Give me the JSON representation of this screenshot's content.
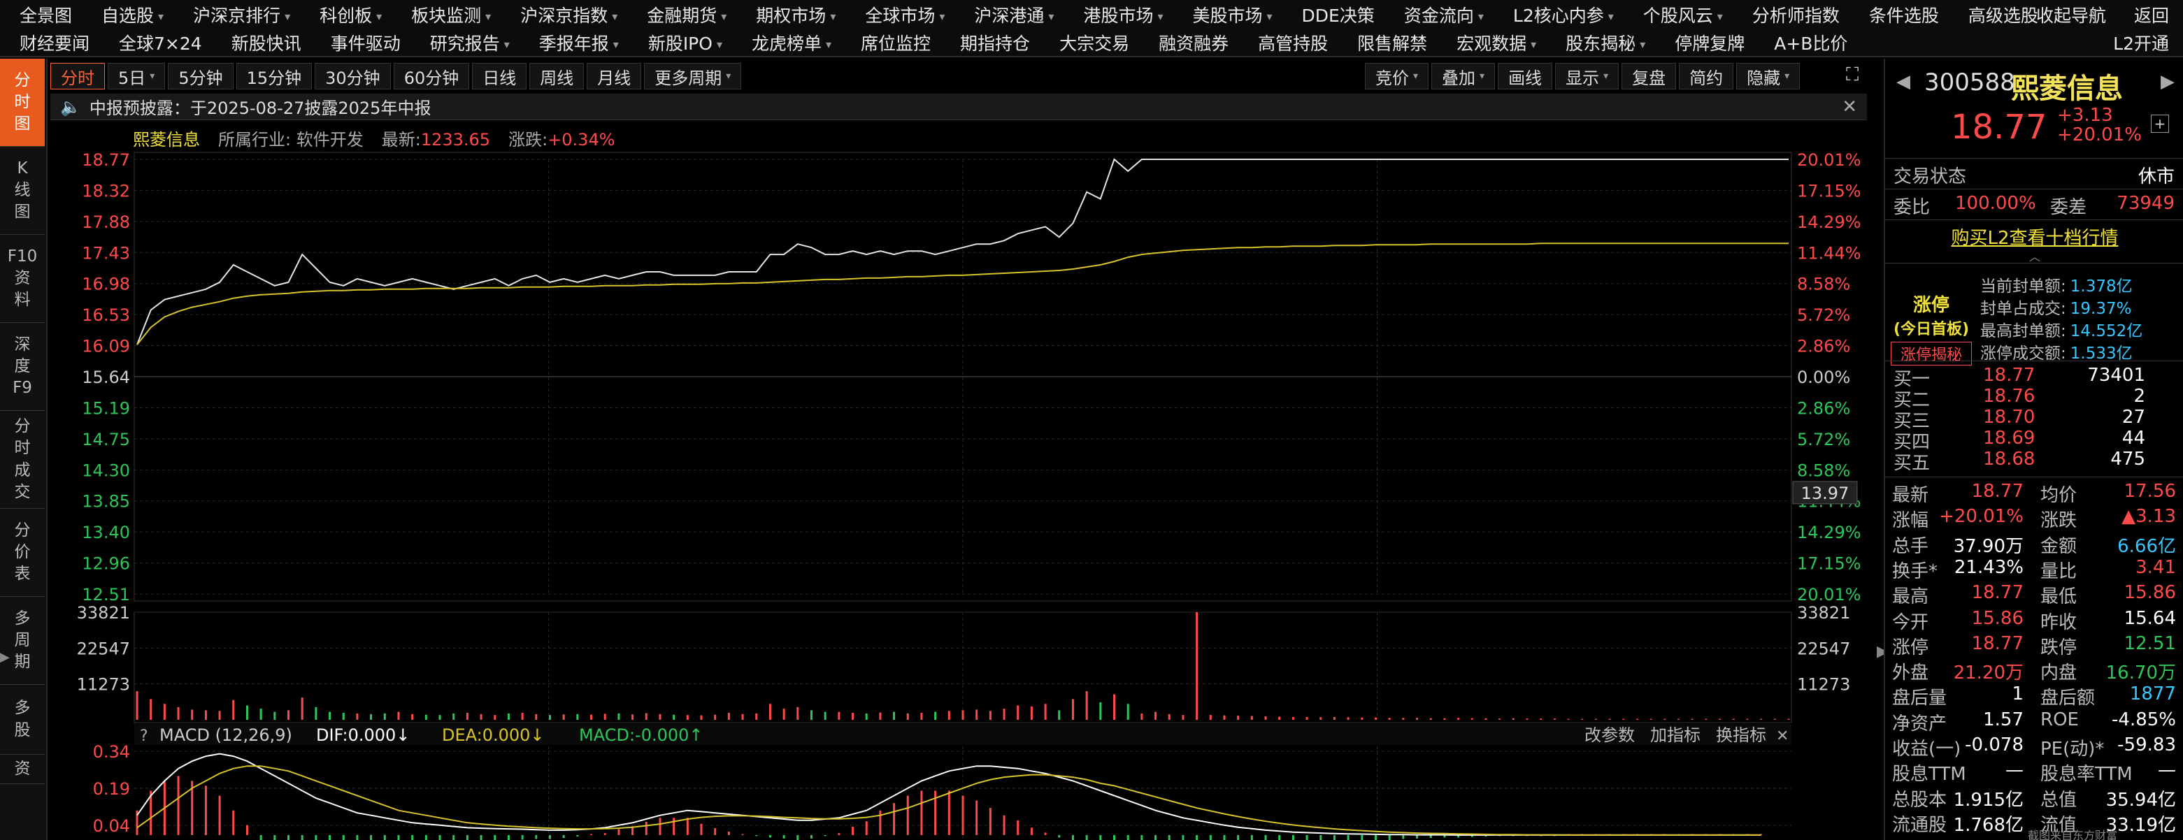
{
  "menu1": {
    "items": [
      "全景图",
      "自选股",
      "沪深京排行",
      "科创板",
      "板块监测",
      "沪深京指数",
      "金融期货",
      "期权市场",
      "全球市场",
      "沪深港通",
      "港股市场",
      "美股市场",
      "DDE决策",
      "资金流向",
      "L2核心内参",
      "个股风云",
      "分析师指数",
      "条件选股",
      "高级选股"
    ],
    "dropdown": [
      false,
      true,
      true,
      true,
      true,
      true,
      true,
      true,
      true,
      true,
      true,
      true,
      false,
      true,
      true,
      true,
      false,
      false,
      false
    ],
    "right": [
      "收起导航",
      "返回"
    ]
  },
  "menu2": {
    "items": [
      "财经要闻",
      "全球7×24",
      "新股快讯",
      "事件驱动",
      "研究报告",
      "季报年报",
      "新股IPO",
      "龙虎榜单",
      "席位监控",
      "期指持仓",
      "大宗交易",
      "融资融券",
      "高管持股",
      "限售解禁",
      "宏观数据",
      "股东揭秘",
      "停牌复牌",
      "A+B比价"
    ],
    "dropdown": [
      false,
      false,
      false,
      false,
      true,
      true,
      true,
      true,
      false,
      false,
      false,
      false,
      false,
      false,
      true,
      true,
      false,
      false
    ],
    "right": [
      "L2开通"
    ]
  },
  "sidebar": [
    {
      "label": "分\n时\n图",
      "active": true
    },
    {
      "label": "K\n线\n图",
      "active": false
    },
    {
      "label": "F10\n资\n料",
      "active": false
    },
    {
      "label": "深\n度\nF9",
      "active": false
    },
    {
      "label": "分\n时\n成\n交",
      "active": false
    },
    {
      "label": "分\n价\n表",
      "active": false
    },
    {
      "label": "多\n周\n期",
      "active": false
    },
    {
      "label": "多\n股",
      "active": false
    },
    {
      "label": "资",
      "active": false
    }
  ],
  "toolbar": {
    "periods": [
      "分时",
      "5日",
      "5分钟",
      "15分钟",
      "30分钟",
      "60分钟",
      "日线",
      "周线",
      "月线",
      "更多周期"
    ],
    "period_dropdown": [
      false,
      true,
      false,
      false,
      false,
      false,
      false,
      false,
      false,
      true
    ],
    "right": [
      "竞价",
      "叠加",
      "画线",
      "显示",
      "复盘",
      "简约",
      "隐藏"
    ]
  },
  "notice": {
    "text": "中报预披露：于2025-08-27披露2025年中报",
    "close": "✕"
  },
  "info": {
    "name": "熙菱信息",
    "industry_label": "所属行业:",
    "industry": "软件开发",
    "latest_label": "最新:",
    "latest": "1233.65",
    "change_label": "涨跌:",
    "change": "+0.34%"
  },
  "quote": {
    "code": "300588",
    "name": "熙菱信息",
    "price": "18.77",
    "change": "+3.13",
    "pct": "+20.01%"
  },
  "status": {
    "label": "交易状态",
    "value": "休市"
  },
  "weibi": {
    "label": "委比",
    "value": "100.00%",
    "diff_label": "委差",
    "diff": "73949"
  },
  "buy_l2": "购买L2查看十档行情",
  "limit_up": {
    "badge1": "涨停",
    "badge2": "(今日首板)",
    "badge3": "涨停揭秘",
    "rows": [
      {
        "label": "当前封单额:",
        "value": "1.378亿"
      },
      {
        "label": "封单占成交:",
        "value": "19.37%"
      },
      {
        "label": "最高封单额:",
        "value": "14.552亿"
      },
      {
        "label": "涨停成交额:",
        "value": "1.533亿"
      }
    ]
  },
  "orderbook": [
    {
      "label": "买一",
      "price": "18.77",
      "vol": "73401"
    },
    {
      "label": "买二",
      "price": "18.76",
      "vol": "2"
    },
    {
      "label": "买三",
      "price": "18.70",
      "vol": "27"
    },
    {
      "label": "买四",
      "price": "18.69",
      "vol": "44"
    },
    {
      "label": "买五",
      "price": "18.68",
      "vol": "475"
    }
  ],
  "stats": [
    {
      "l1": "最新",
      "v1": "18.77",
      "c1": "red",
      "l2": "均价",
      "v2": "17.56",
      "c2": "red"
    },
    {
      "l1": "涨幅",
      "v1": "+20.01%",
      "c1": "red",
      "l2": "涨跌",
      "v2": "▲3.13",
      "c2": "red"
    },
    {
      "l1": "总手",
      "v1": "37.90万",
      "c1": "white",
      "l2": "金额",
      "v2": "6.66亿",
      "c2": "cyan"
    },
    {
      "l1": "换手*",
      "v1": "21.43%",
      "c1": "white",
      "l2": "量比",
      "v2": "3.41",
      "c2": "red"
    },
    {
      "l1": "最高",
      "v1": "18.77",
      "c1": "red",
      "l2": "最低",
      "v2": "15.86",
      "c2": "red"
    },
    {
      "l1": "今开",
      "v1": "15.86",
      "c1": "red",
      "l2": "昨收",
      "v2": "15.64",
      "c2": "white"
    },
    {
      "l1": "涨停",
      "v1": "18.77",
      "c1": "red",
      "l2": "跌停",
      "v2": "12.51",
      "c2": "green"
    },
    {
      "l1": "外盘",
      "v1": "21.20万",
      "c1": "red",
      "l2": "内盘",
      "v2": "16.70万",
      "c2": "green"
    },
    {
      "l1": "盘后量",
      "v1": "1",
      "c1": "white",
      "l2": "盘后额",
      "v2": "1877",
      "c2": "cyan"
    },
    {
      "l1": "净资产",
      "v1": "1.57",
      "c1": "white",
      "l2": "ROE",
      "v2": "-4.85%",
      "c2": "white"
    },
    {
      "l1": "收益(一)",
      "v1": "-0.078",
      "c1": "white",
      "l2": "PE(动)*",
      "v2": "-59.83",
      "c2": "white"
    },
    {
      "l1": "股息TTM",
      "v1": "—",
      "c1": "white",
      "l2": "股息率TTM",
      "v2": "—",
      "c2": "white"
    },
    {
      "l1": "总股本",
      "v1": "1.915亿",
      "c1": "white",
      "l2": "总值",
      "v2": "35.94亿",
      "c2": "white"
    },
    {
      "l1": "流通股",
      "v1": "1.768亿",
      "c1": "white",
      "l2": "流值",
      "v2": "33.19亿",
      "c2": "white"
    }
  ],
  "chart_labels": {
    "price_ticks": [
      "18.77",
      "18.32",
      "17.88",
      "17.43",
      "16.98",
      "16.53",
      "16.09",
      "15.64",
      "15.19",
      "14.75",
      "14.30",
      "13.85",
      "13.40",
      "12.96",
      "12.51"
    ],
    "pct_ticks": [
      "20.01%",
      "17.15%",
      "14.29%",
      "11.44%",
      "8.58%",
      "5.72%",
      "2.86%",
      "0.00%",
      "2.86%",
      "5.72%",
      "8.58%",
      "11.44%",
      "14.29%",
      "17.15%",
      "20.01%"
    ],
    "crosshair_value": "13.97",
    "vol_ticks": [
      "33821",
      "22547",
      "11273"
    ],
    "macd_ticks": [
      "0.34",
      "0.19",
      "0.04"
    ],
    "macd_title": "MACD (12,26,9)",
    "dif": "DIF:0.000↓",
    "dea": "DEA:0.000↓",
    "macd": "MACD:-0.000↑",
    "macd_buttons": [
      "改参数",
      "加指标",
      "换指标"
    ],
    "help": "?",
    "watermark": "截图来自东方财富"
  },
  "colors": {
    "up": "#ff4a4a",
    "down": "#2ec55a",
    "price_line": "#e6e6e6",
    "avg_line": "#d9c32a",
    "grid": "#2a2a2a",
    "accent": "#e85a1e"
  },
  "chart_data": {
    "type": "line",
    "ylim": [
      12.51,
      18.77
    ],
    "prev_close": 15.64,
    "price": [
      16.1,
      16.6,
      16.75,
      16.8,
      16.85,
      16.9,
      17.0,
      17.25,
      17.15,
      17.05,
      16.95,
      17.0,
      17.4,
      17.2,
      17.0,
      16.95,
      17.05,
      17.0,
      16.95,
      17.0,
      17.05,
      17.0,
      16.95,
      16.9,
      16.95,
      17.0,
      17.05,
      16.95,
      17.05,
      17.1,
      17.0,
      17.05,
      17.0,
      17.05,
      17.1,
      17.05,
      17.1,
      17.15,
      17.15,
      17.1,
      17.1,
      17.1,
      17.1,
      17.15,
      17.15,
      17.15,
      17.4,
      17.4,
      17.55,
      17.5,
      17.4,
      17.4,
      17.45,
      17.4,
      17.45,
      17.4,
      17.45,
      17.45,
      17.4,
      17.45,
      17.5,
      17.55,
      17.55,
      17.6,
      17.7,
      17.75,
      17.8,
      17.65,
      17.85,
      18.3,
      18.2,
      18.77,
      18.6,
      18.77,
      18.77,
      18.77,
      18.77,
      18.77,
      18.77,
      18.77,
      18.77,
      18.77,
      18.77,
      18.77,
      18.77,
      18.77,
      18.77,
      18.77,
      18.77,
      18.77,
      18.77,
      18.77,
      18.77,
      18.77,
      18.77,
      18.77,
      18.77,
      18.77,
      18.77,
      18.77,
      18.77,
      18.77,
      18.77,
      18.77,
      18.77,
      18.77,
      18.77,
      18.77,
      18.77,
      18.77,
      18.77,
      18.77,
      18.77,
      18.77,
      18.77,
      18.77,
      18.77,
      18.77,
      18.77,
      18.77,
      18.77
    ],
    "avg": [
      16.1,
      16.35,
      16.5,
      16.58,
      16.64,
      16.68,
      16.72,
      16.77,
      16.8,
      16.82,
      16.83,
      16.84,
      16.86,
      16.87,
      16.88,
      16.88,
      16.89,
      16.89,
      16.9,
      16.9,
      16.9,
      16.91,
      16.91,
      16.91,
      16.91,
      16.92,
      16.92,
      16.92,
      16.93,
      16.93,
      16.93,
      16.94,
      16.94,
      16.94,
      16.95,
      16.95,
      16.95,
      16.96,
      16.96,
      16.97,
      16.97,
      16.97,
      16.98,
      16.98,
      16.99,
      16.99,
      17.0,
      17.01,
      17.02,
      17.03,
      17.04,
      17.04,
      17.05,
      17.06,
      17.06,
      17.07,
      17.08,
      17.08,
      17.09,
      17.1,
      17.1,
      17.11,
      17.12,
      17.13,
      17.14,
      17.15,
      17.16,
      17.17,
      17.19,
      17.22,
      17.25,
      17.3,
      17.36,
      17.4,
      17.42,
      17.44,
      17.46,
      17.47,
      17.48,
      17.49,
      17.5,
      17.5,
      17.51,
      17.51,
      17.52,
      17.52,
      17.52,
      17.53,
      17.53,
      17.53,
      17.54,
      17.54,
      17.54,
      17.54,
      17.55,
      17.55,
      17.55,
      17.55,
      17.55,
      17.55,
      17.55,
      17.55,
      17.56,
      17.56,
      17.56,
      17.56,
      17.56,
      17.56,
      17.56,
      17.56,
      17.56,
      17.56,
      17.56,
      17.56,
      17.56,
      17.56,
      17.56,
      17.56,
      17.56,
      17.56,
      17.56
    ],
    "volume": [
      9000,
      6500,
      5000,
      4000,
      3200,
      3000,
      2800,
      6200,
      4500,
      3500,
      2500,
      3000,
      7000,
      4000,
      2500,
      2200,
      2000,
      1800,
      2000,
      2500,
      1800,
      1600,
      1500,
      2000,
      2200,
      1800,
      1500,
      2000,
      2200,
      1800,
      1500,
      1700,
      1800,
      1600,
      1900,
      2000,
      1700,
      2100,
      1800,
      1600,
      1500,
      1400,
      1600,
      2200,
      1800,
      2000,
      5000,
      3500,
      4000,
      3000,
      2500,
      2500,
      2200,
      2000,
      2300,
      2500,
      2000,
      2200,
      2500,
      2800,
      3000,
      3200,
      2800,
      3500,
      4500,
      4200,
      5000,
      3000,
      6500,
      9000,
      5500,
      8000,
      5000,
      2000,
      2500,
      1800,
      1500,
      33821,
      1500,
      1400,
      1300,
      1200,
      1100,
      1000,
      900,
      900,
      800,
      900,
      800,
      700,
      700,
      600,
      600,
      600,
      500,
      500,
      600,
      500,
      500,
      400,
      500,
      400,
      400,
      400,
      300,
      300,
      300,
      300,
      300,
      300,
      300,
      300,
      300,
      300,
      300,
      300,
      300,
      300,
      300,
      300,
      300
    ],
    "macd_range": [
      -0.02,
      0.36
    ],
    "dif": [
      0.08,
      0.16,
      0.22,
      0.27,
      0.3,
      0.32,
      0.33,
      0.32,
      0.3,
      0.27,
      0.24,
      0.21,
      0.18,
      0.15,
      0.13,
      0.11,
      0.09,
      0.08,
      0.07,
      0.06,
      0.05,
      0.045,
      0.04,
      0.035,
      0.03,
      0.028,
      0.026,
      0.025,
      0.024,
      0.022,
      0.02,
      0.02,
      0.022,
      0.025,
      0.03,
      0.04,
      0.05,
      0.065,
      0.08,
      0.09,
      0.1,
      0.095,
      0.09,
      0.085,
      0.08,
      0.075,
      0.07,
      0.065,
      0.06,
      0.06,
      0.065,
      0.07,
      0.085,
      0.1,
      0.13,
      0.16,
      0.19,
      0.22,
      0.24,
      0.26,
      0.27,
      0.28,
      0.28,
      0.275,
      0.27,
      0.26,
      0.25,
      0.235,
      0.22,
      0.2,
      0.18,
      0.16,
      0.14,
      0.12,
      0.1,
      0.085,
      0.07,
      0.06,
      0.05,
      0.04,
      0.032,
      0.026,
      0.02,
      0.016,
      0.012,
      0.01,
      0.008,
      0.006,
      0.005,
      0.004,
      0.003,
      0.002,
      0.002,
      0.001,
      0.001,
      0.001,
      0.0,
      0.0,
      0.0,
      0.0,
      0.0,
      0.0,
      0.0,
      0.0,
      0.0,
      0.0,
      0.0,
      0.0,
      0.0,
      0.0,
      0.0,
      0.0,
      0.0,
      0.0,
      0.0,
      0.0,
      0.0,
      0.0,
      0.0
    ],
    "dea": [
      0.03,
      0.07,
      0.11,
      0.15,
      0.19,
      0.22,
      0.25,
      0.27,
      0.28,
      0.28,
      0.27,
      0.26,
      0.24,
      0.22,
      0.2,
      0.18,
      0.16,
      0.14,
      0.12,
      0.1,
      0.09,
      0.08,
      0.07,
      0.06,
      0.05,
      0.045,
      0.04,
      0.036,
      0.033,
      0.03,
      0.028,
      0.026,
      0.025,
      0.025,
      0.026,
      0.028,
      0.032,
      0.038,
      0.045,
      0.055,
      0.065,
      0.072,
      0.076,
      0.078,
      0.078,
      0.077,
      0.075,
      0.072,
      0.07,
      0.067,
      0.066,
      0.066,
      0.068,
      0.072,
      0.08,
      0.095,
      0.11,
      0.13,
      0.15,
      0.17,
      0.19,
      0.21,
      0.225,
      0.235,
      0.24,
      0.245,
      0.245,
      0.24,
      0.235,
      0.225,
      0.21,
      0.2,
      0.185,
      0.17,
      0.155,
      0.14,
      0.125,
      0.11,
      0.098,
      0.086,
      0.075,
      0.065,
      0.056,
      0.048,
      0.041,
      0.035,
      0.03,
      0.025,
      0.021,
      0.018,
      0.015,
      0.012,
      0.01,
      0.008,
      0.007,
      0.006,
      0.005,
      0.004,
      0.003,
      0.002,
      0.002,
      0.001,
      0.001,
      0.001,
      0.0,
      0.0,
      0.0,
      0.0,
      0.0,
      0.0,
      0.0,
      0.0,
      0.0,
      0.0,
      0.0,
      0.0,
      0.0,
      0.0,
      0.0
    ]
  }
}
